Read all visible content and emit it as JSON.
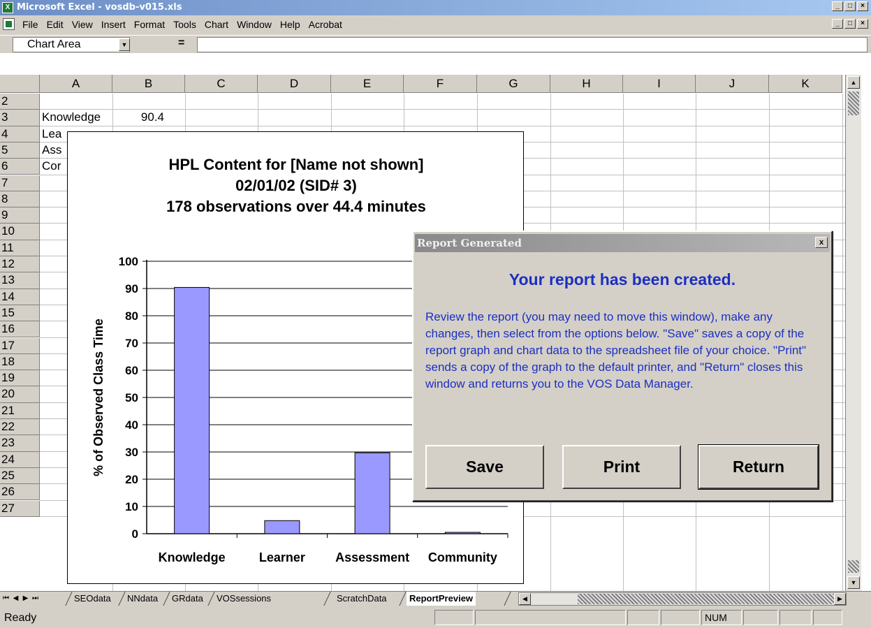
{
  "window": {
    "title": "Microsoft Excel - vosdb-v015.xls"
  },
  "menu": [
    "File",
    "Edit",
    "View",
    "Insert",
    "Format",
    "Tools",
    "Chart",
    "Window",
    "Help",
    "Acrobat"
  ],
  "formula_bar": {
    "name_box": "Chart Area",
    "equals": "="
  },
  "columns": [
    "A",
    "B",
    "C",
    "D",
    "E",
    "F",
    "G",
    "H",
    "I",
    "J",
    "K"
  ],
  "rows": [
    "2",
    "3",
    "4",
    "5",
    "6",
    "7",
    "8",
    "9",
    "10",
    "11",
    "12",
    "13",
    "14",
    "15",
    "16",
    "17",
    "18",
    "19",
    "20",
    "21",
    "22",
    "23",
    "24",
    "25",
    "26",
    "27"
  ],
  "cells": {
    "a3": "Knowledge",
    "b3": "90.4",
    "a4": "Lea",
    "a5": "Ass",
    "a6": "Cor"
  },
  "chart_data": {
    "type": "bar",
    "title_lines": [
      "HPL Content for [Name not shown]",
      "02/01/02 (SID# 3)",
      "178 observations over 44.4 minutes"
    ],
    "ylabel": "% of Observed Class Time",
    "categories": [
      "Knowledge",
      "Learner",
      "Assessment",
      "Community"
    ],
    "values": [
      90.4,
      4.8,
      29.7,
      0.5
    ],
    "ylim": [
      0,
      100
    ],
    "yticks": [
      0,
      10,
      20,
      30,
      40,
      50,
      60,
      70,
      80,
      90,
      100
    ],
    "grid": true,
    "bar_color": "#9999ff"
  },
  "dialog": {
    "title": "Report Generated",
    "close": "x",
    "heading": "Your report has been created.",
    "body": "Review the report (you may need to move this window), make any changes, then select from the options below. \"Save\" saves a copy of the report graph and chart data to the spreadsheet file of your choice.  \"Print\" sends a copy of the graph to the default printer, and \"Return\" closes this window and returns you to the VOS Data Manager.",
    "buttons": {
      "save": "Save",
      "print": "Print",
      "return": "Return"
    },
    "text_color": "#1c2fc1"
  },
  "sheet_tabs": [
    "SEOdata",
    "NNdata",
    "GRdata",
    "VOSsessions",
    "ScratchData",
    "ReportPreview"
  ],
  "active_tab": "ReportPreview",
  "status": {
    "text": "Ready",
    "num": "NUM"
  }
}
